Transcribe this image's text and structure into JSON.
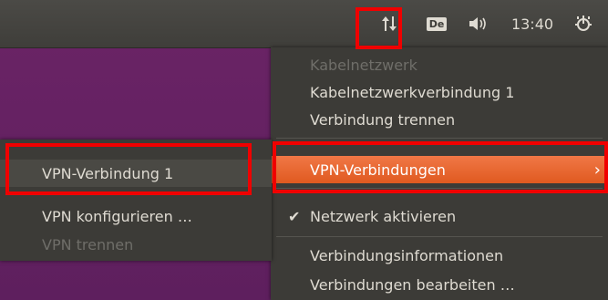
{
  "panel": {
    "network_icon": "network-up-down-icon",
    "keyboard_layout": "De",
    "sound_icon": "speaker-icon",
    "clock": "13:40",
    "session_icon": "power-gear-icon"
  },
  "menu": {
    "items": [
      {
        "label": "Kabelnetzwerk",
        "enabled": false
      },
      {
        "label": "Kabelnetzwerkverbindung 1",
        "enabled": true
      },
      {
        "label": "Verbindung trennen",
        "enabled": true
      },
      {
        "label": "VPN-Verbindungen",
        "enabled": true,
        "highlighted": true,
        "submenu_arrow": "›"
      },
      {
        "label": "Netzwerk aktivieren",
        "enabled": true,
        "checked": true,
        "check_mark": "✔"
      },
      {
        "label": "Verbindungsinformationen",
        "enabled": true
      },
      {
        "label": "Verbindungen bearbeiten …",
        "enabled": true
      }
    ]
  },
  "submenu": {
    "items": [
      {
        "label": "VPN-Verbindung 1",
        "enabled": true
      },
      {
        "label": "VPN konfigurieren …",
        "enabled": true
      },
      {
        "label": "VPN trennen",
        "enabled": false
      }
    ]
  },
  "colors": {
    "panel": "#3f3e3a",
    "menu_background": "#3c3b37",
    "menu_highlight": "#e95420",
    "annotation": "#f00000",
    "desktop": "#5e1f5e"
  }
}
